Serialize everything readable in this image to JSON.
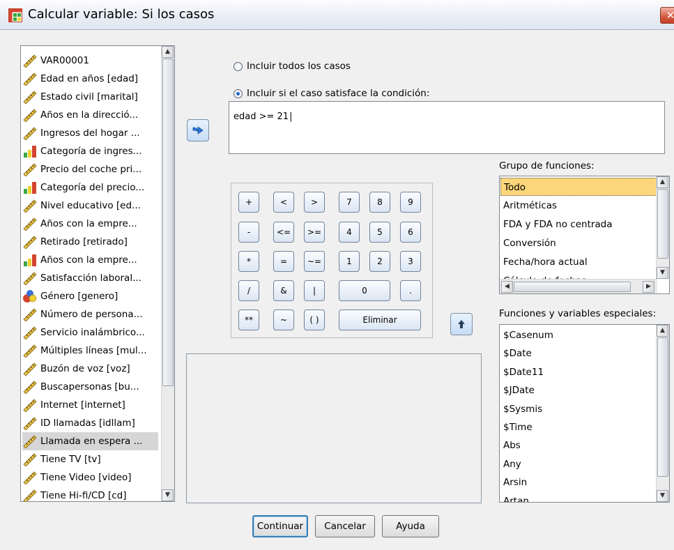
{
  "window": {
    "title": "Calcular variable: Si los casos",
    "close_label": "✕"
  },
  "variables": [
    {
      "label": "VAR00001",
      "type": "scale"
    },
    {
      "label": "Edad en años [edad]",
      "type": "scale"
    },
    {
      "label": "Estado civil [marital]",
      "type": "scale"
    },
    {
      "label": "Años en la direcció...",
      "type": "scale"
    },
    {
      "label": "Ingresos del hogar ...",
      "type": "scale"
    },
    {
      "label": "Categoría de ingres...",
      "type": "ordinal"
    },
    {
      "label": "Precio del coche pri...",
      "type": "scale"
    },
    {
      "label": "Categoría del precio...",
      "type": "ordinal"
    },
    {
      "label": "Nivel educativo [ed...",
      "type": "scale"
    },
    {
      "label": "Años con la empre...",
      "type": "scale"
    },
    {
      "label": "Retirado [retirado]",
      "type": "scale"
    },
    {
      "label": "Años con la empre...",
      "type": "ordinal"
    },
    {
      "label": "Satisfacción laboral...",
      "type": "scale"
    },
    {
      "label": "Género [genero]",
      "type": "nominal"
    },
    {
      "label": "Número de persona...",
      "type": "scale"
    },
    {
      "label": "Servicio inalámbrico...",
      "type": "scale"
    },
    {
      "label": "Múltiples líneas [mul...",
      "type": "scale"
    },
    {
      "label": "Buzón de voz [voz]",
      "type": "scale"
    },
    {
      "label": "Buscapersonas [bu...",
      "type": "scale"
    },
    {
      "label": "Internet [internet]",
      "type": "scale"
    },
    {
      "label": "ID llamadas [idllam]",
      "type": "scale"
    },
    {
      "label": "Llamada en espera ...",
      "type": "scale",
      "selected": true
    },
    {
      "label": "Tiene TV [tv]",
      "type": "scale"
    },
    {
      "label": "Tiene Video [video]",
      "type": "scale"
    },
    {
      "label": "Tiene Hi-fi/CD [cd]",
      "type": "scale"
    }
  ],
  "radios": {
    "all_cases": "Incluir todos los casos",
    "if_condition": "Incluir si el caso satisface la condición:",
    "selected": "if_condition"
  },
  "expression": "edad >= 21",
  "keypad": {
    "plus": "+",
    "lt": "<",
    "gt": ">",
    "k7": "7",
    "k8": "8",
    "k9": "9",
    "minus": "-",
    "le": "<=",
    "ge": ">=",
    "k4": "4",
    "k5": "5",
    "k6": "6",
    "mult": "*",
    "eq": "=",
    "ne": "~=",
    "k1": "1",
    "k2": "2",
    "k3": "3",
    "div": "/",
    "and": "&",
    "or": "|",
    "k0": "0",
    "dot": ".",
    "pow": "**",
    "not": "~",
    "paren": "( )",
    "delete": "Eliminar"
  },
  "function_group": {
    "label": "Grupo de funciones:",
    "items": [
      "Todo",
      "Aritméticas",
      "FDA y FDA no centrada",
      "Conversión",
      "Fecha/hora actual",
      "Cálculo de fechas"
    ],
    "selected_index": 0
  },
  "special_functions": {
    "label": "Funciones y variables especiales:",
    "items": [
      "$Casenum",
      "$Date",
      "$Date11",
      "$JDate",
      "$Sysmis",
      "$Time",
      "Abs",
      "Any",
      "Arsin",
      "Artan"
    ]
  },
  "buttons": {
    "continue": "Continuar",
    "cancel": "Cancelar",
    "help": "Ayuda"
  },
  "colors": {
    "selection": "#fcd67a",
    "accent": "#1e64c8",
    "arrow_fill": "#2a78d6"
  }
}
